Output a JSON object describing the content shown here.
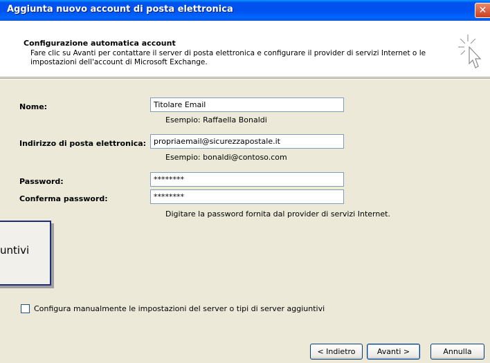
{
  "window": {
    "title": "Aggiunta nuovo account di posta elettronica",
    "close_label": "✕"
  },
  "header": {
    "title": "Configurazione automatica account",
    "description": "Fare clic su Avanti per contattare il server di posta elettronica e configurare il provider di servizi Internet o le impostazioni dell'account di Microsoft Exchange."
  },
  "form": {
    "name_label": "Nome:",
    "name_value": "Titolare Email",
    "name_hint": "Esempio: Raffaella Bonaldi",
    "email_label": "Indirizzo di posta elettronica:",
    "email_value": "propriaemail@sicurezzapostale.it",
    "email_hint": "Esempio: bonaldi@contoso.com",
    "password_label": "Password:",
    "password_value": "********",
    "confirm_label": "Conferma password:",
    "confirm_value": "********",
    "password_hint": "Digitare la password fornita dal provider di servizi Internet."
  },
  "overlay": {
    "text": "untivi"
  },
  "manual_config": {
    "label": "Configura manualmente le impostazioni del server o tipi di server aggiuntivi",
    "checked": false
  },
  "buttons": {
    "back": "< Indietro",
    "next": "Avanti >",
    "cancel": "Annulla"
  },
  "icons": {
    "wizard": "cursor-sparkle-icon",
    "close": "close-icon"
  }
}
